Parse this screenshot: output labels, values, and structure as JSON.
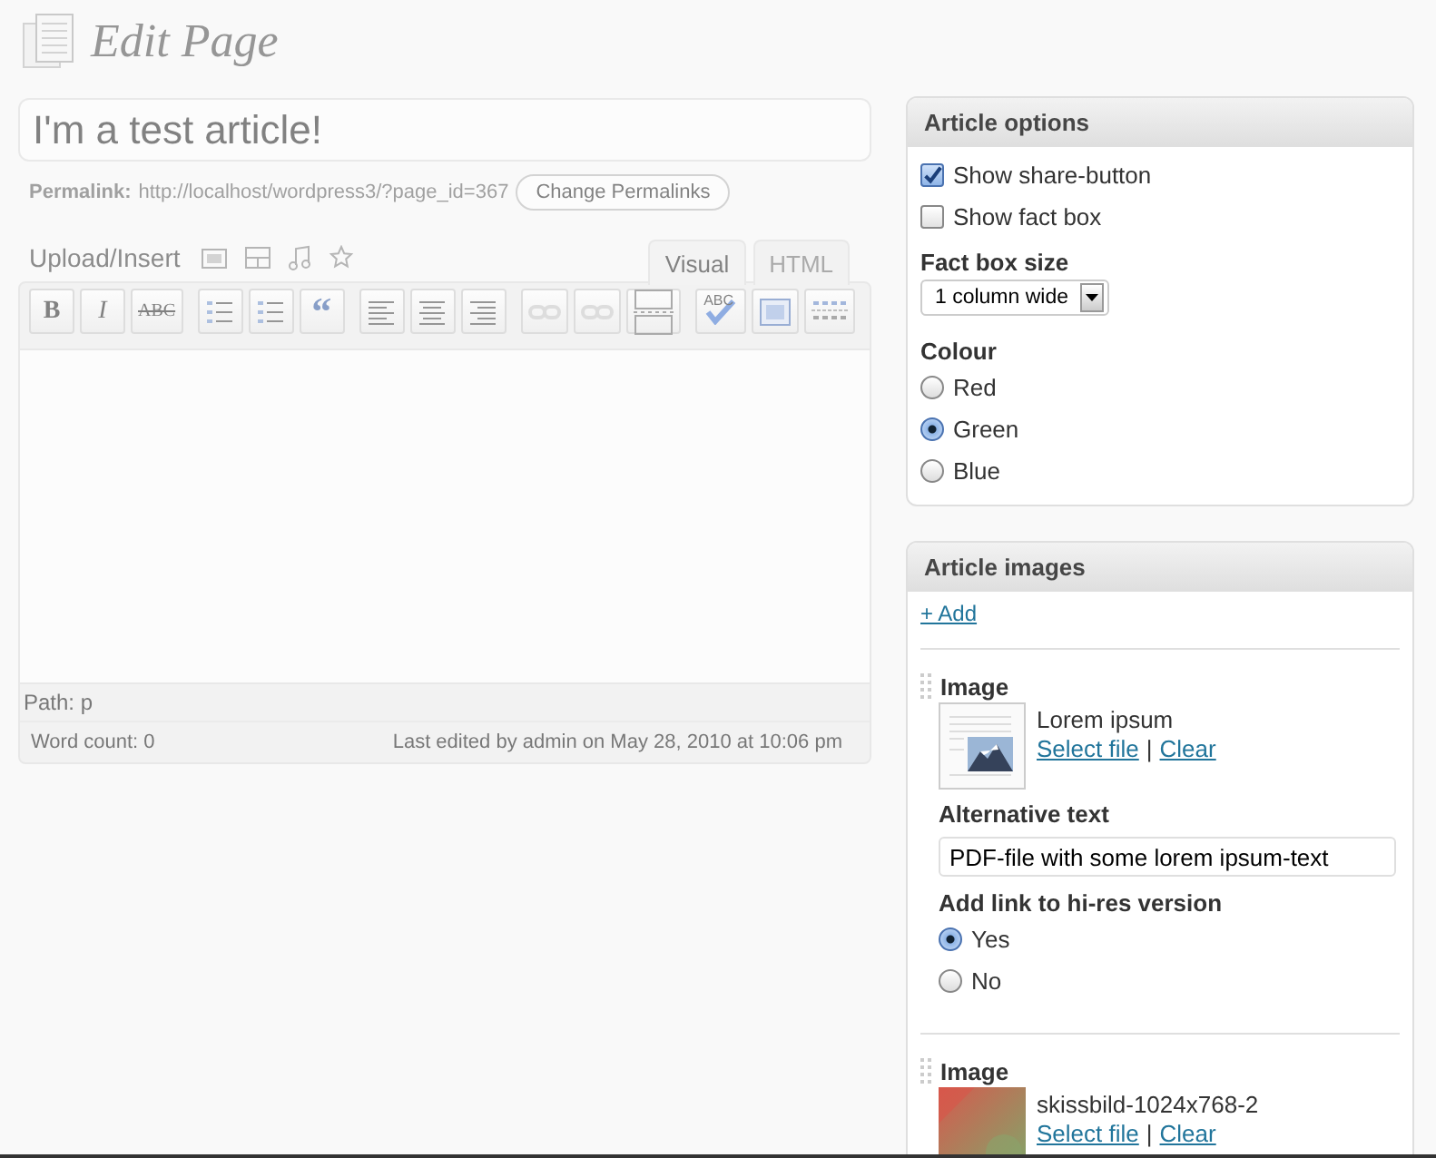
{
  "header": {
    "title": "Edit Page"
  },
  "editor": {
    "disabled": true,
    "title_value": "I'm a test article!",
    "permalink_label": "Permalink:",
    "permalink_url": "http://localhost/wordpress3/?page_id=367",
    "change_button": "Change Permalinks",
    "upload_label": "Upload/Insert",
    "tabs": [
      {
        "label": "Visual",
        "selected": true
      },
      {
        "label": "HTML",
        "selected": false
      }
    ],
    "toolbar": [
      [
        {
          "kind": "bold",
          "label": "B"
        },
        {
          "kind": "italic",
          "label": "I"
        },
        {
          "kind": "strike",
          "label": "ABC"
        }
      ],
      [
        {
          "kind": "bullets"
        },
        {
          "kind": "numbers"
        },
        {
          "kind": "quote",
          "label": "“"
        }
      ],
      [
        {
          "kind": "align-left"
        },
        {
          "kind": "align-center"
        },
        {
          "kind": "align-right"
        }
      ],
      [
        {
          "kind": "link"
        },
        {
          "kind": "unlink"
        },
        {
          "kind": "more"
        }
      ],
      [
        {
          "kind": "spell",
          "label": "ABC"
        },
        {
          "kind": "fullscreen"
        },
        {
          "kind": "kitchen"
        }
      ]
    ],
    "path": "Path: p",
    "word_count": "Word count: 0",
    "last_edited": "Last edited by admin on May 28, 2010 at 10:06 pm"
  },
  "options_panel": {
    "title": "Article options",
    "checkboxes": [
      {
        "label": "Show share-button",
        "checked": true
      },
      {
        "label": "Show fact box",
        "checked": false
      }
    ],
    "size_label": "Fact box size",
    "size_value": "1 column wide",
    "colour_label": "Colour",
    "colours": [
      {
        "label": "Red",
        "selected": false
      },
      {
        "label": "Green",
        "selected": true
      },
      {
        "label": "Blue",
        "selected": false
      }
    ]
  },
  "images_panel": {
    "title": "Article images",
    "add_link": "+ Add",
    "images": [
      {
        "heading": "Image",
        "kind": "document",
        "file_name": "Lorem ipsum",
        "select_link": "Select file",
        "separator": "|",
        "clear_link": "Clear",
        "alt_label": "Alternative text",
        "alt_value": "PDF-file with some lorem ipsum-text",
        "link_label": "Add link to hi-res version",
        "link_options": [
          {
            "label": "Yes",
            "selected": true
          },
          {
            "label": "No",
            "selected": false
          }
        ]
      },
      {
        "heading": "Image",
        "kind": "picture",
        "file_name": "skissbild-1024x768-2",
        "select_link": "Select file",
        "separator": "|",
        "clear_link": "Clear"
      }
    ]
  }
}
